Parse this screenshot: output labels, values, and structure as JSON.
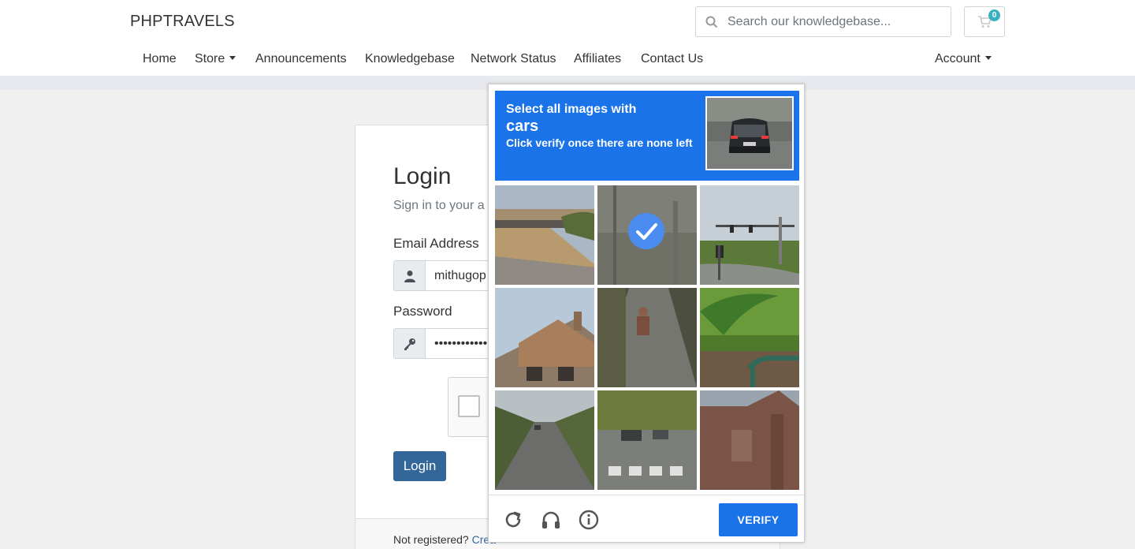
{
  "brand": "PHPTRAVELS",
  "search": {
    "placeholder": "Search our knowledgebase..."
  },
  "cart": {
    "count": "0"
  },
  "nav": {
    "home": "Home",
    "store": "Store",
    "announcements": "Announcements",
    "knowledgebase": "Knowledgebase",
    "network_status": "Network Status",
    "affiliates": "Affiliates",
    "contact_us": "Contact Us",
    "account": "Account"
  },
  "login": {
    "title": "Login",
    "subtitle": "Sign in to your a",
    "email_label": "Email Address",
    "email_value": "mithugop",
    "password_label": "Password",
    "password_value": "••••••••••••",
    "button": "Login",
    "not_registered": "Not registered?",
    "create_link": "Crea"
  },
  "captcha": {
    "line1": "Select all images with",
    "target": "cars",
    "line3": "Click verify once there are none left",
    "verify_label": "VERIFY",
    "tiles": [
      {
        "subject": "overpass",
        "selected": false
      },
      {
        "subject": "road-noise",
        "selected": true
      },
      {
        "subject": "traffic-lights",
        "selected": false
      },
      {
        "subject": "houses",
        "selected": false
      },
      {
        "subject": "path-person",
        "selected": false
      },
      {
        "subject": "grass-palm",
        "selected": false
      },
      {
        "subject": "road-trees",
        "selected": false
      },
      {
        "subject": "street-crosswalk",
        "selected": false
      },
      {
        "subject": "brick-house",
        "selected": false
      }
    ]
  }
}
